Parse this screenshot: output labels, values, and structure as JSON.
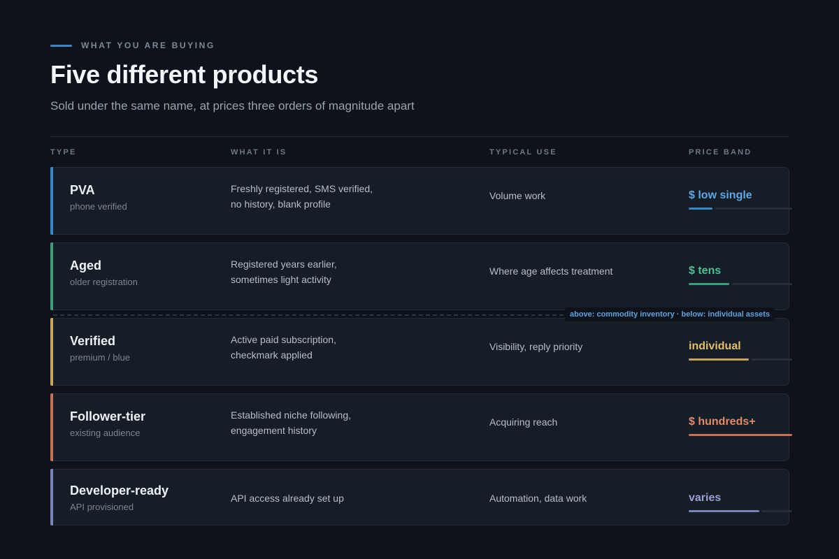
{
  "header": {
    "eyebrow": "WHAT YOU ARE BUYING",
    "title": "Five different products",
    "subtitle": "Sold under the same name, at prices three orders of magnitude apart"
  },
  "columns": {
    "type": "TYPE",
    "what": "WHAT IT IS",
    "use": "TYPICAL USE",
    "price": "PRICE BAND"
  },
  "divider": {
    "label": "above: commodity inventory · below: individual assets"
  },
  "rows": [
    {
      "name": "PVA",
      "sub": "phone verified",
      "what_line1": "Freshly registered, SMS verified,",
      "what_line2": "no history, blank profile",
      "use": "Volume work",
      "price": "$ low single",
      "color": "#3a86c9",
      "price_color": "#5ea8e6",
      "level": 0.23
    },
    {
      "name": "Aged",
      "sub": "older registration",
      "what_line1": "Registered years earlier,",
      "what_line2": "sometimes light activity",
      "use": "Where age affects treatment",
      "price": "$ tens",
      "color": "#3f9c7c",
      "price_color": "#4fbf93",
      "level": 0.39
    },
    {
      "name": "Verified",
      "sub": "premium / blue",
      "what_line1": "Active paid subscription,",
      "what_line2": "checkmark applied",
      "use": "Visibility, reply priority",
      "price": "individual",
      "color": "#c9a55a",
      "price_color": "#e4bf6a",
      "level": 0.58
    },
    {
      "name": "Follower-tier",
      "sub": "existing audience",
      "what_line1": "Established niche following,",
      "what_line2": "engagement history",
      "use": "Acquiring reach",
      "price": "$ hundreds+",
      "color": "#c96f52",
      "price_color": "#e08a6b",
      "level": 1.0
    },
    {
      "name": "Developer-ready",
      "sub": "API provisioned",
      "what_line1": "API access already set up",
      "what_line2": "",
      "use": "Automation, data work",
      "price": "varies",
      "color": "#7b82b8",
      "price_color": "#9aa0d2",
      "level": 0.68
    }
  ]
}
